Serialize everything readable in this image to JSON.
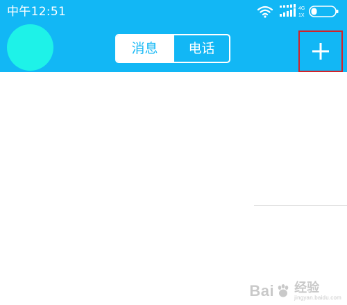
{
  "status_bar": {
    "time": "中午12:51",
    "network_label_top": "4G",
    "network_label_bottom": "1X",
    "icons": [
      "wifi-icon",
      "signal-bars-icon",
      "battery-icon"
    ]
  },
  "header": {
    "avatar_color": "#1ef2e8",
    "tabs": [
      {
        "label": "消息",
        "selected": true
      },
      {
        "label": "电话",
        "selected": false
      }
    ],
    "add_icon": "plus-icon"
  },
  "watermark": {
    "brand": "Bai",
    "brand_suffix": "",
    "cn": "经验",
    "url": "jingyan.baidu.com"
  },
  "colors": {
    "header_bg": "#12b7f5",
    "highlight_box": "#d2232a"
  }
}
